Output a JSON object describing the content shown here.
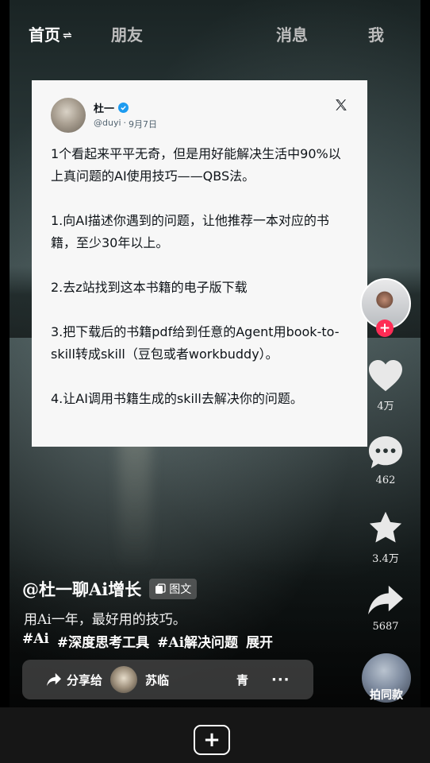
{
  "tweet": {
    "author_name": "杜一",
    "handle": "@duyi",
    "separator": "·",
    "date": "9月7日",
    "paragraphs": [
      "1个看起来平平无奇，但是用好能解决生活中90%以上真问题的AI使用技巧——QBS法。",
      "1.向AI描述你遇到的问题，让他推荐一本对应的书籍，至少30年以上。",
      "2.去z站找到这本书籍的电子版下载",
      "3.把下载后的书籍pdf给到任意的Agent用book-to-skill转成skill（豆包或者workbuddy）。",
      "4.让AI调用书籍生成的skill去解决你的问题。"
    ]
  },
  "rail": {
    "likes": "4万",
    "comments": "462",
    "favorites": "3.4万",
    "shares": "5687",
    "same_style_label": "拍同款"
  },
  "caption": {
    "author": "@杜一聊Ai增长",
    "type_badge": "图文",
    "description": "用Ai一年，最好用的技巧。",
    "tags": [
      "#Ai",
      "#深度思考工具",
      "#Ai解决问题"
    ],
    "expand": "展开"
  },
  "share_bar": {
    "label": "分享给",
    "friend": "苏临",
    "extra": "青",
    "more": "···"
  },
  "nav": {
    "home": "首页",
    "home_swap": "⇌",
    "friends": "朋友",
    "plus": "+",
    "messages": "消息",
    "me": "我"
  },
  "colors": {
    "follow_red": "#fe2c55",
    "verified_blue": "#1d9bf0",
    "card_bg": "#f7f7f7",
    "nav_bg": "#161616"
  }
}
